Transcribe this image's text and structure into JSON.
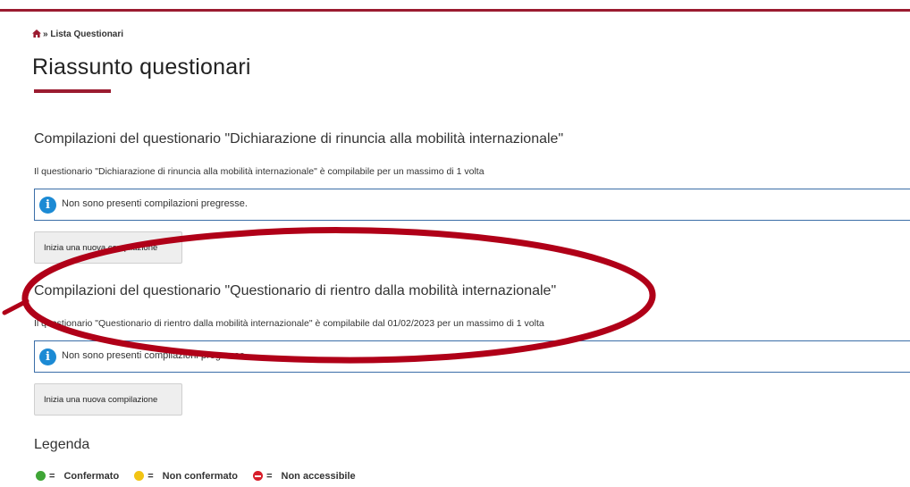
{
  "colors": {
    "brand": "#9b1b30",
    "info": "#1c8ad4",
    "box_border": "#3b6ea8",
    "annotation": "#b00018",
    "status_confirmed": "#3fa536",
    "status_unconfirmed": "#f2c414",
    "status_noaccess": "#d81e2a"
  },
  "breadcrumb": {
    "icon": "home-icon",
    "separator": "»",
    "current": "Lista Questionari"
  },
  "page": {
    "title": "Riassunto questionari"
  },
  "sections": [
    {
      "title": "Compilazioni del questionario \"Dichiarazione di rinuncia alla mobilità internazionale\"",
      "description": "Il questionario \"Dichiarazione di rinuncia alla mobilità internazionale\"  è compilabile per un massimo di 1 volta",
      "info": "Non sono presenti compilazioni pregresse.",
      "button": "Inizia una nuova compilazione"
    },
    {
      "title": "Compilazioni del questionario \"Questionario di rientro dalla mobilità internazionale\"",
      "description": "Il questionario \"Questionario di rientro dalla mobilità internazionale\"  è compilabile dal 01/02/2023  per un massimo di 1 volta",
      "info": "Non sono presenti compilazioni pregresse.",
      "button": "Inizia una nuova compilazione"
    }
  ],
  "legend": {
    "title": "Legenda",
    "equals": "=",
    "items": [
      {
        "icon": "status-confirmed-icon",
        "label": "Confermato"
      },
      {
        "icon": "status-unconfirmed-icon",
        "label": "Non confermato"
      },
      {
        "icon": "status-noaccess-icon",
        "label": "Non accessibile"
      }
    ]
  }
}
